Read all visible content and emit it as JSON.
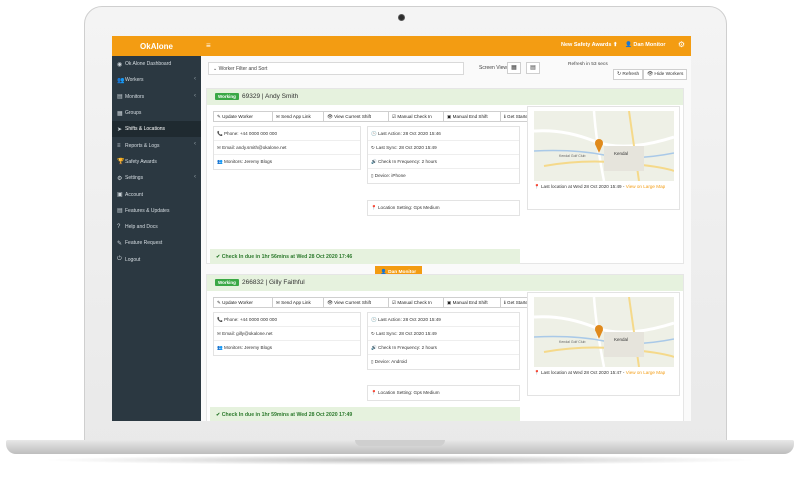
{
  "app": {
    "brand": "OkAlone"
  },
  "sidebar": {
    "items": [
      {
        "label": "Ok Alone Dashboard",
        "icon": "dashboard-icon",
        "glyph": "◉",
        "chevron": ""
      },
      {
        "label": "Workers",
        "icon": "users-icon",
        "glyph": "👥",
        "chevron": "‹"
      },
      {
        "label": "Monitors",
        "icon": "monitor-icon",
        "glyph": "▤",
        "chevron": "‹"
      },
      {
        "label": "Groups",
        "icon": "groups-icon",
        "glyph": "▦",
        "chevron": ""
      },
      {
        "label": "Shifts & Locations",
        "icon": "location-arrow-icon",
        "glyph": "➤",
        "chevron": ""
      },
      {
        "label": "Reports & Logs",
        "icon": "reports-icon",
        "glyph": "≡",
        "chevron": "‹"
      },
      {
        "label": "Safety Awards",
        "icon": "trophy-icon",
        "glyph": "🏆",
        "chevron": ""
      },
      {
        "label": "Settings",
        "icon": "gear-icon",
        "glyph": "⚙",
        "chevron": "‹"
      },
      {
        "label": "Account",
        "icon": "account-icon",
        "glyph": "▣",
        "chevron": ""
      },
      {
        "label": "Features & Updates",
        "icon": "features-icon",
        "glyph": "▤",
        "chevron": ""
      },
      {
        "label": "Help and Docs",
        "icon": "help-icon",
        "glyph": "?",
        "chevron": ""
      },
      {
        "label": "Feature Request",
        "icon": "request-icon",
        "glyph": "✎",
        "chevron": ""
      },
      {
        "label": "Logout",
        "icon": "logout-icon",
        "glyph": "⏻",
        "chevron": ""
      }
    ]
  },
  "topbar": {
    "awards": "New Safety Awards ⬆",
    "user": "👤 Dan Monitor",
    "menu_glyph": "≡",
    "gear_glyph": "⚙"
  },
  "toolbar": {
    "filter": "⌄ Worker Filter and Sort",
    "screen_view": "Screen View",
    "grid_glyph": "▦",
    "list_glyph": "▤",
    "refresh_text": "Refresh in 53 secs",
    "refresh_button": "↻ Refresh",
    "hide_workers_button": "👁 Hide Workers"
  },
  "workers": [
    {
      "status": "Working",
      "name": "69329 | Andy Smith",
      "actions": [
        "✎ Update Worker",
        "✉ Send App Link",
        "👁 View Current Shift",
        "☑ Manual Check In",
        "▣ Manual End Shift",
        "ℹ Get Started"
      ],
      "contact": [
        "📞 Phone: +44 0000 000 000",
        "✉ Email: andy.smith@okalone.net",
        "👥 Monitors: Jeremy Blogs"
      ],
      "status_info": [
        "🕓 Last Action: 28 Oct 2020 15:46",
        "↻ Last Sync: 28 Oct 2020 15:49",
        "🔊 Check In Frequency: 2 hours",
        "▯ Device: iPhone"
      ],
      "location_setting": "📍 Location Setting: Gps Medium",
      "map_location": "📍 Last location at Wed 28 Oct 2020 15:49 - ",
      "map_link": "View on Large Map",
      "map_label": "Kendal",
      "map_label2": "Kendal Golf Club",
      "due": "✔ Check In due in 1hr 56mins at Wed 28 Oct 2020 17:46",
      "monitor_button": "👤 Dan Monitor"
    },
    {
      "status": "Working",
      "name": "266832 | Gilly Faithful",
      "actions": [
        "✎ Update Worker",
        "✉ Send App Link",
        "👁 View Current Shift",
        "☑ Manual Check In",
        "▣ Manual End Shift",
        "ℹ Get Started"
      ],
      "contact": [
        "📞 Phone: +44 0000 000 000",
        "✉ Email: gilly@okalone.net",
        "👥 Monitors: Jeremy Blogs"
      ],
      "status_info": [
        "🕓 Last Action: 28 Oct 2020 15:49",
        "↻ Last Sync: 28 Oct 2020 15:49",
        "🔊 Check In Frequency: 2 hours",
        "▯ Device: Android"
      ],
      "location_setting": "📍 Location Setting: Gps Medium",
      "map_location": "📍 Last location at Wed 28 Oct 2020 15:47 - ",
      "map_link": "View on Large Map",
      "map_label": "Kendal",
      "map_label2": "Kendal Golf Club",
      "due": "✔ Check In due in 1hr 59mins at Wed 28 Oct 2020 17:49",
      "monitor_button": ""
    }
  ],
  "colors": {
    "accent": "#f39c12",
    "sidebar": "#2b3841",
    "working": "#3aa845",
    "panel_green": "#e6f2de"
  }
}
